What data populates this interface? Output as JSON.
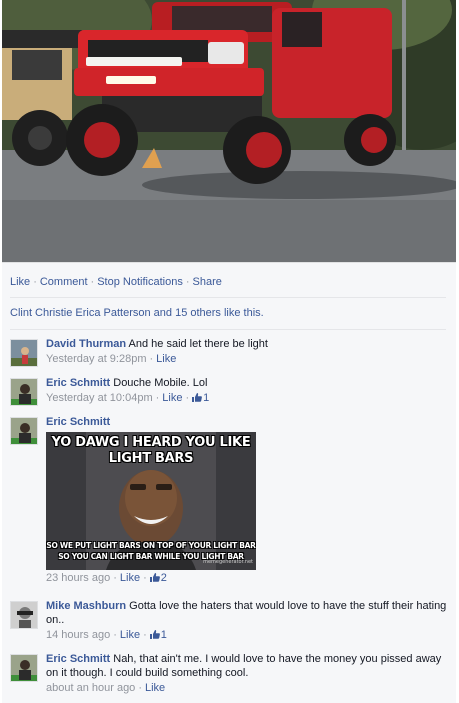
{
  "post": {
    "actions": [
      "Like",
      "Comment",
      "Stop Notifications",
      "Share"
    ],
    "likes_text": "Clint Christie Erica Patterson and 15 others like this."
  },
  "comments": [
    {
      "author": "David Thurman",
      "text": "And he said let there be light",
      "time": "Yesterday at 9:28pm",
      "like_label": "Like",
      "like_count": ""
    },
    {
      "author": "Eric Schmitt",
      "text": "Douche Mobile. Lol",
      "time": "Yesterday at 10:04pm",
      "like_label": "Like",
      "like_count": "1"
    },
    {
      "author": "Eric Schmitt",
      "text": "",
      "time": "23 hours ago",
      "like_label": "Like",
      "like_count": "2",
      "meme": {
        "top_caption": "YO DAWG I HEARD YOU LIKE LIGHT BARS",
        "bottom_caption": "SO WE PUT LIGHT BARS ON TOP OF YOUR LIGHT BAR SO YOU CAN LIGHT BAR WHILE YOU LIGHT BAR",
        "watermark": "memegenerator.net"
      }
    },
    {
      "author": "Mike Mashburn",
      "text": "Gotta love the haters that would love to have the stuff their hating on..",
      "time": "14 hours ago",
      "like_label": "Like",
      "like_count": "1"
    },
    {
      "author": "Eric Schmitt",
      "text": "Nah, that ain't me. I would love to have the money you pissed away on it though. I could build something cool.",
      "time": "about an hour ago",
      "like_label": "Like",
      "like_count": ""
    }
  ],
  "colors": {
    "link": "#3b5998",
    "meta": "#90949c",
    "panel": "#f6f7f9",
    "truck_red": "#d9262b"
  },
  "icons": [
    "thumbs-up-icon"
  ]
}
